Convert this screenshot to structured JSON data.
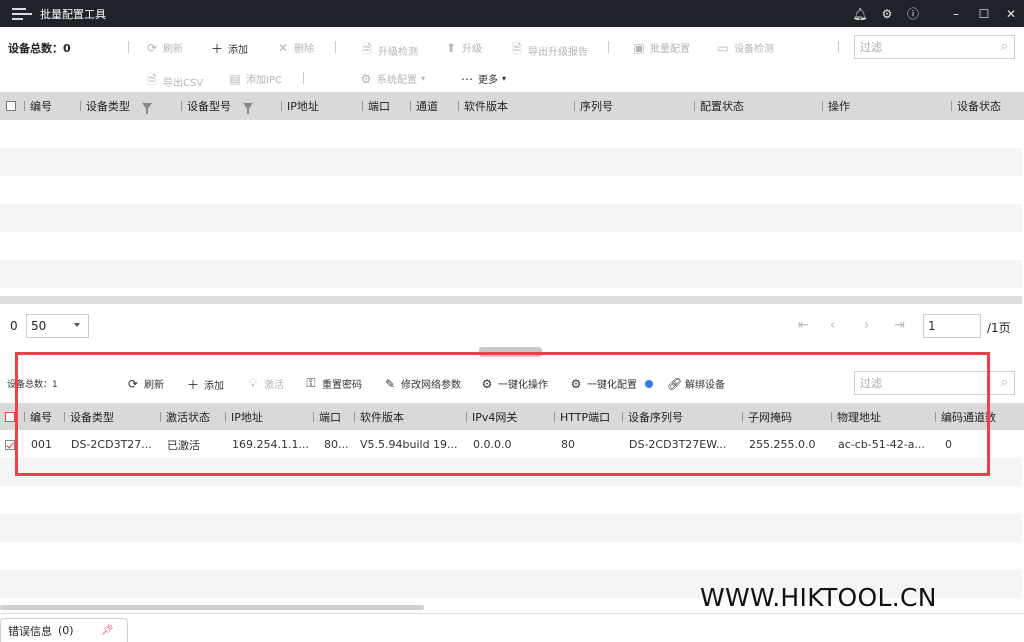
{
  "app": {
    "title": "批量配置工具"
  },
  "toolbar_top": {
    "device_count_label": "设备总数：",
    "device_count": "0",
    "refresh": "刷新",
    "add": "添加",
    "delete": "删除",
    "upgrade_check": "升级检测",
    "upgrade": "升级",
    "export_upgrade_report": "导出升级报告",
    "batch_config": "批量配置",
    "device_check": "设备检测",
    "filter_placeholder": "过滤",
    "export_csv": "导出CSV",
    "add_ipc": "添加IPC",
    "system_config": "系统配置",
    "more": "更多"
  },
  "top_table": {
    "columns": [
      "编号",
      "设备类型",
      "设备型号",
      "IP地址",
      "端口",
      "通道",
      "软件版本",
      "序列号",
      "配置状态",
      "操作",
      "设备状态"
    ]
  },
  "pager": {
    "count": "0",
    "page_size": "50",
    "page_input": "1",
    "page_total": "/1页"
  },
  "toolbar_bottom": {
    "device_count_label": "设备总数：",
    "device_count": "1",
    "refresh": "刷新",
    "add": "添加",
    "activate": "激活",
    "reset_password": "重置密码",
    "modify_network": "修改网络参数",
    "one_click_op": "一键化操作",
    "one_click_config": "一键化配置",
    "unbind": "解绑设备",
    "filter_placeholder": "过滤"
  },
  "bottom_table": {
    "columns": [
      "编号",
      "设备类型",
      "激活状态",
      "IP地址",
      "端口",
      "软件版本",
      "IPv4网关",
      "HTTP端口",
      "设备序列号",
      "子网掩码",
      "物理地址",
      "编码通道数"
    ],
    "rows": [
      [
        "001",
        "DS-2CD3T27...",
        "已激活",
        "169.254.1.1...",
        "80...",
        "V5.5.94build 19...",
        "0.0.0.0",
        "80",
        "DS-2CD3T27EW...",
        "255.255.0.0",
        "ac-cb-51-42-a...",
        "0"
      ]
    ]
  },
  "bottom_tab": {
    "label": "错误信息",
    "count": "(0)"
  },
  "watermark": "WWW.HIKTOOL.CN",
  "colors": {
    "titlebar": "#1f2229",
    "header": "#d9d9d9",
    "highlight": "#e8424a",
    "stripe": "#f5f5f5"
  }
}
